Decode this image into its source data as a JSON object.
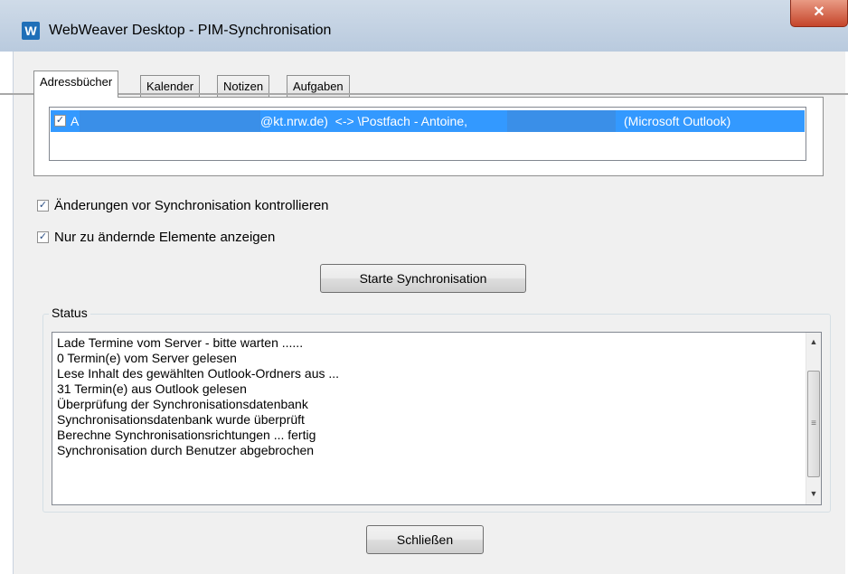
{
  "window": {
    "title": "WebWeaver Desktop - PIM-Synchronisation",
    "app_icon_letter": "W",
    "close_glyph": "✕"
  },
  "tabs": [
    {
      "label": "Adressbücher",
      "active": true
    },
    {
      "label": "Kalender",
      "active": false
    },
    {
      "label": "Notizen",
      "active": false
    },
    {
      "label": "Aufgaben",
      "active": false
    }
  ],
  "sync_list": {
    "rows": [
      {
        "checked": true,
        "prefix": "A",
        "part1": "@kt.nrw.de)  <-> \\Postfach - Antoine,",
        "part2": "(Microsoft Outlook)"
      }
    ]
  },
  "options": {
    "check_changes": {
      "label": "Änderungen vor Synchronisation kontrollieren",
      "checked": true
    },
    "show_changed_only": {
      "label": "Nur zu ändernde Elemente anzeigen",
      "checked": true
    }
  },
  "buttons": {
    "start_sync": "Starte Synchronisation",
    "close": "Schließen"
  },
  "status": {
    "label": "Status",
    "lines": [
      "Lade Termine vom Server - bitte warten ......",
      "0 Termin(e) vom Server gelesen",
      "Lese Inhalt des gewählten Outlook-Ordners aus ...",
      "31 Termin(e) aus Outlook gelesen",
      "Überprüfung der Synchronisationsdatenbank",
      "Synchronisationsdatenbank wurde überprüft",
      "Berechne Synchronisationsrichtungen ... fertig",
      "Synchronisation durch Benutzer abgebrochen"
    ]
  },
  "colors": {
    "selection": "#3399ff",
    "close_button": "#c5452a",
    "title_bar": "#c4d3e4"
  },
  "icons": {
    "checkbox_check": "✓",
    "scroll_up": "▲",
    "scroll_down": "▼",
    "scroll_grip": "≡"
  }
}
